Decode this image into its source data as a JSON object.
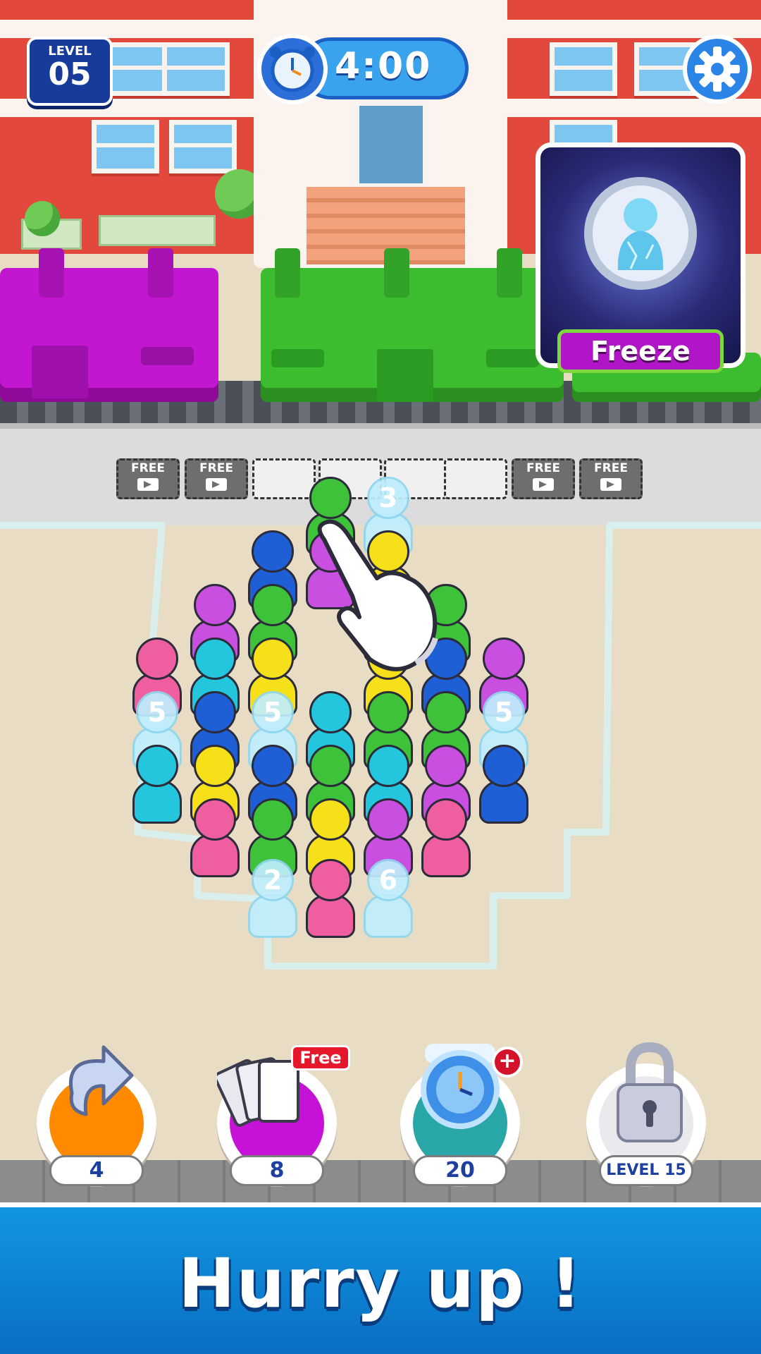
{
  "hud": {
    "level_label": "LEVEL",
    "level_number": "05",
    "timer": "4:00"
  },
  "slots": {
    "free_label": "FREE",
    "row": [
      "free",
      "free",
      "empty",
      "empty",
      "empty",
      "empty",
      "free",
      "free"
    ]
  },
  "booster_card": {
    "label": "Freeze"
  },
  "characters": [
    {
      "color": "#3ec23a",
      "col": 3.0,
      "row": -1.2
    },
    {
      "color": "#bfeefd",
      "col": 4.0,
      "row": -1.2,
      "ice": true,
      "num": "3"
    },
    {
      "color": "#1f5fd6",
      "col": 2.0,
      "row": -0.4
    },
    {
      "color": "#c94fe0",
      "col": 3.0,
      "row": -0.4
    },
    {
      "color": "#f5e01a",
      "col": 4.0,
      "row": -0.4
    },
    {
      "color": "#c94fe0",
      "col": 1.0,
      "row": 0.4
    },
    {
      "color": "#3ec23a",
      "col": 2.0,
      "row": 0.4
    },
    {
      "color": "#23c6dc",
      "col": 4.0,
      "row": 0.4
    },
    {
      "color": "#3ec23a",
      "col": 5.0,
      "row": 0.4
    },
    {
      "color": "#ef5fa0",
      "col": 0.0,
      "row": 1.2
    },
    {
      "color": "#23c6dc",
      "col": 1.0,
      "row": 1.2
    },
    {
      "color": "#f5e01a",
      "col": 2.0,
      "row": 1.2
    },
    {
      "color": "#f5e01a",
      "col": 4.0,
      "row": 1.2
    },
    {
      "color": "#1f5fd6",
      "col": 5.0,
      "row": 1.2
    },
    {
      "color": "#c94fe0",
      "col": 6.0,
      "row": 1.2
    },
    {
      "color": "#bfeefd",
      "col": 0.0,
      "row": 2.0,
      "ice": true,
      "num": "5"
    },
    {
      "color": "#1f5fd6",
      "col": 1.0,
      "row": 2.0
    },
    {
      "color": "#bfeefd",
      "col": 2.0,
      "row": 2.0,
      "ice": true,
      "num": "5"
    },
    {
      "color": "#23c6dc",
      "col": 3.0,
      "row": 2.0
    },
    {
      "color": "#3ec23a",
      "col": 4.0,
      "row": 2.0
    },
    {
      "color": "#3ec23a",
      "col": 5.0,
      "row": 2.0
    },
    {
      "color": "#bfeefd",
      "col": 6.0,
      "row": 2.0,
      "ice": true,
      "num": "5"
    },
    {
      "color": "#23c6dc",
      "col": 0.0,
      "row": 2.8
    },
    {
      "color": "#f5e01a",
      "col": 1.0,
      "row": 2.8
    },
    {
      "color": "#1f5fd6",
      "col": 2.0,
      "row": 2.8
    },
    {
      "color": "#3ec23a",
      "col": 3.0,
      "row": 2.8
    },
    {
      "color": "#23c6dc",
      "col": 4.0,
      "row": 2.8
    },
    {
      "color": "#c94fe0",
      "col": 5.0,
      "row": 2.8
    },
    {
      "color": "#1f5fd6",
      "col": 6.0,
      "row": 2.8
    },
    {
      "color": "#ef5fa0",
      "col": 1.0,
      "row": 3.6
    },
    {
      "color": "#3ec23a",
      "col": 2.0,
      "row": 3.6
    },
    {
      "color": "#f5e01a",
      "col": 3.0,
      "row": 3.6
    },
    {
      "color": "#c94fe0",
      "col": 4.0,
      "row": 3.6
    },
    {
      "color": "#ef5fa0",
      "col": 5.0,
      "row": 3.6
    },
    {
      "color": "#bfeefd",
      "col": 2.0,
      "row": 4.5,
      "ice": true,
      "num": "2"
    },
    {
      "color": "#ef5fa0",
      "col": 3.0,
      "row": 4.5
    },
    {
      "color": "#bfeefd",
      "col": 4.0,
      "row": 4.5,
      "ice": true,
      "num": "6"
    }
  ],
  "boosters": [
    {
      "name": "undo",
      "count": "4",
      "color": "#ff8a00"
    },
    {
      "name": "shuffle",
      "count": "8",
      "color": "#c612d6",
      "tag": "Free"
    },
    {
      "name": "freeze-time",
      "count": "20",
      "color": "#29a7a8",
      "badge": "+"
    },
    {
      "name": "locked",
      "count": "LEVEL 15",
      "color": "#e9e9ee"
    }
  ],
  "banner": {
    "text": "Hurry up !"
  }
}
